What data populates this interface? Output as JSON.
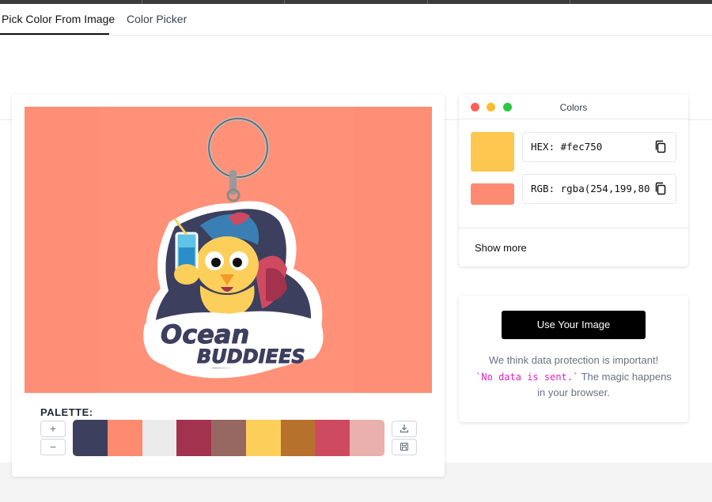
{
  "tabs": [
    {
      "label": "Pick Color From Image",
      "active": true
    },
    {
      "label": "Color Picker",
      "active": false
    }
  ],
  "palette": {
    "label": "PALETTE:",
    "add_symbol": "+",
    "remove_symbol": "−",
    "colors": [
      "#3c3f5e",
      "#fe8a6f",
      "#ebebeb",
      "#a3324f",
      "#976761",
      "#fccf5a",
      "#b6712d",
      "#cd4a60",
      "#e9b0ad"
    ],
    "download_icon": "download-icon",
    "save_icon": "save-icon"
  },
  "image": {
    "background": "#ff8e76",
    "logo_line1": "Ocean",
    "logo_line2": "BUDDIEES"
  },
  "colors_panel": {
    "title": "Colors",
    "window_dots": [
      "#fe5f57",
      "#febc2e",
      "#28c840"
    ],
    "primary_swatch": "#fec750",
    "secondary_swatch": "#fe8a72",
    "hex_label": "HEX: #fec750",
    "rgb_label": "RGB: rgba(254,199,80",
    "copy_icon": "copy-icon",
    "show_more": "Show more"
  },
  "upload": {
    "button_label": "Use Your Image",
    "text_before": "We think data protection is important!",
    "code_text": "`No data is sent.`",
    "text_after": " The magic happens in your browser."
  }
}
